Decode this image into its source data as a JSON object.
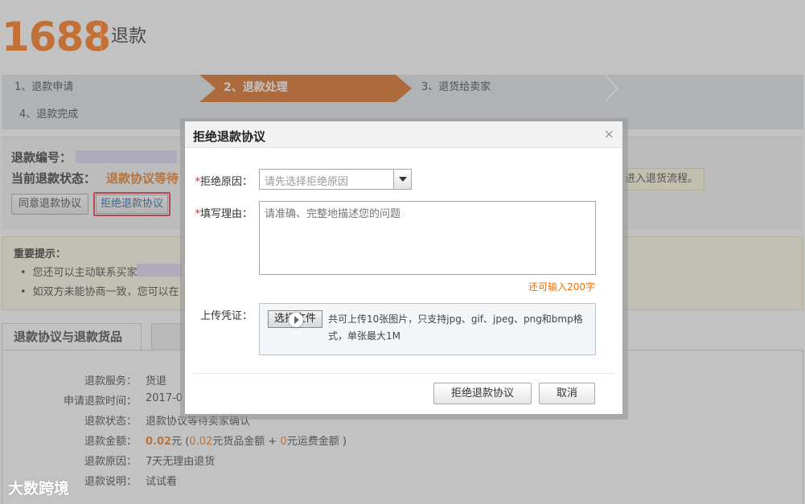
{
  "header": {
    "logo": "1688",
    "title": "退款"
  },
  "steps": [
    {
      "label": "1、退款申请",
      "active": false
    },
    {
      "label": "2、退款处理",
      "active": true
    },
    {
      "label": "3、退货给卖家",
      "active": false
    },
    {
      "label": "4、退款完成",
      "active": false
    }
  ],
  "refund": {
    "number_label": "退款编号：",
    "status_label": "当前退款状态：",
    "status_value": "退款协议等待",
    "agree_button": "同意退款协议",
    "reject_button": "拒绝退款协议",
    "notice_right": "进入退货流程。"
  },
  "tips": {
    "title": "重要提示：",
    "items": [
      "您还可以主动联系买家",
      "如双方未能协商一致，您可以在"
    ]
  },
  "tabs": {
    "active": "退款协议与退款货品"
  },
  "details": {
    "service_label": "退款服务：",
    "service_value": "货退",
    "time_label": "申请退款时间：",
    "time_value": "2017-0",
    "status_label": "退款状态：",
    "status_value": "退款协议等待卖家确认",
    "amount_label": "退款金额：",
    "amount_value": "0.02",
    "amount_unit": "元 (",
    "goods_amount": "0.02",
    "goods_text": "元货品金额 +",
    "freight_amount": "0",
    "freight_text": "元运费金额 )",
    "reason_label": "退款原因：",
    "reason_value": "7天无理由退货",
    "desc_label": "退款说明：",
    "desc_value": "试试看"
  },
  "modal": {
    "title": "拒绝退款协议",
    "close": "×",
    "reason_label": "拒绝原因：",
    "reason_placeholder": "请先选择拒绝原因",
    "fill_label": "填写理由：",
    "fill_placeholder": "请准确、完整地描述您的问题",
    "remaining": "还可输入200字",
    "upload_label": "上传凭证：",
    "file_button": "选择文件",
    "upload_hint": "共可上传10张图片，只支持jpg、gif、jpeg、png和bmp格式，单张最大1M",
    "confirm_button": "拒绝退款协议",
    "cancel_button": "取消",
    "required_mark": "*"
  },
  "watermark": "大数跨境",
  "colors": {
    "brand": "#ff6a00",
    "active_step": "#d9600d",
    "highlight": "#e8700f",
    "required": "#e5212e"
  }
}
